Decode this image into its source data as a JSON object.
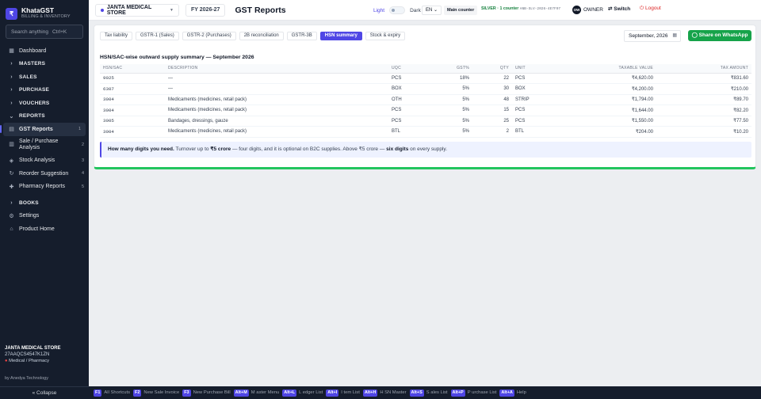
{
  "brand": {
    "name": "KhataGST",
    "tagline": "BILLING & INVENTORY",
    "logo": "₹"
  },
  "search": {
    "placeholder": "Search anything",
    "shortcut": "Ctrl+K"
  },
  "sidebar": {
    "items": [
      {
        "label": "Dashboard",
        "icon": "grid-icon",
        "type": "link"
      },
      {
        "label": "MASTERS",
        "type": "section"
      },
      {
        "label": "SALES",
        "type": "section"
      },
      {
        "label": "PURCHASE",
        "type": "section"
      },
      {
        "label": "VOUCHERS",
        "type": "section"
      },
      {
        "label": "REPORTS",
        "type": "section-open"
      },
      {
        "label": "GST Reports",
        "count": "1",
        "active": true
      },
      {
        "label": "Sale / Purchase Analysis",
        "count": "2"
      },
      {
        "label": "Stock Analysis",
        "count": "3"
      },
      {
        "label": "Reorder Suggestion",
        "count": "4"
      },
      {
        "label": "Pharmacy Reports",
        "count": "5"
      },
      {
        "label": "BOOKS",
        "type": "section"
      },
      {
        "label": "Settings",
        "icon": "gear-icon",
        "type": "link"
      },
      {
        "label": "Product Home",
        "icon": "home-icon",
        "type": "link"
      }
    ]
  },
  "store_info": {
    "name": "JANTA MEDICAL STORE",
    "gstin": "27AAQCS4547K1ZN",
    "type": "Medical / Pharmacy"
  },
  "byline": "by Anedya Technology",
  "collapse_label": "« Collapse",
  "topbar": {
    "store": "JANTA MEDICAL STORE",
    "fy": "FY 2026-27",
    "title": "GST Reports",
    "theme_light": "Light",
    "theme_dark": "Dark",
    "language": "EN",
    "counter": "Main counter",
    "license": "SILVER · 1 counter",
    "license_code": "ANB-SLV-2026-4E7F97",
    "avatar": "OW",
    "role": "OWNER",
    "switch": "Switch",
    "logout": "Logout"
  },
  "tabs": [
    "Tax liability",
    "GSTR-1 (Sales)",
    "GSTR-2 (Purchases)",
    "2B reconciliation",
    "GSTR-3B",
    "HSN summary",
    "Stock & expiry"
  ],
  "active_tab": "HSN summary",
  "period": "September, 2026",
  "share_label": "Share on WhatsApp",
  "table": {
    "title": "HSN/SAC-wise outward supply summary — September 2026",
    "headers": {
      "hsn": "HSN/SAC",
      "desc": "DESCRIPTION",
      "uqc": "UQC",
      "gst": "GST%",
      "qty": "QTY",
      "unit": "UNIT",
      "taxable": "TAXABLE VALUE",
      "tax": "TAX AMOUNT"
    },
    "rows": [
      {
        "hsn": "9025",
        "desc": "—",
        "uqc": "PCS",
        "gst": "18%",
        "qty": "22",
        "unit": "PCS",
        "taxable": "₹4,620.00",
        "tax": "₹831.60"
      },
      {
        "hsn": "6307",
        "desc": "—",
        "uqc": "BOX",
        "gst": "5%",
        "qty": "30",
        "unit": "BOX",
        "taxable": "₹4,200.00",
        "tax": "₹210.00"
      },
      {
        "hsn": "3004",
        "desc": "Medicaments (medicines, retail pack)",
        "uqc": "OTH",
        "gst": "5%",
        "qty": "48",
        "unit": "STRIP",
        "taxable": "₹1,794.00",
        "tax": "₹89.70"
      },
      {
        "hsn": "3004",
        "desc": "Medicaments (medicines, retail pack)",
        "uqc": "PCS",
        "gst": "5%",
        "qty": "15",
        "unit": "PCS",
        "taxable": "₹1,644.00",
        "tax": "₹82.20"
      },
      {
        "hsn": "3005",
        "desc": "Bandages, dressings, gauze",
        "uqc": "PCS",
        "gst": "5%",
        "qty": "25",
        "unit": "PCS",
        "taxable": "₹1,550.00",
        "tax": "₹77.50"
      },
      {
        "hsn": "3004",
        "desc": "Medicaments (medicines, retail pack)",
        "uqc": "BTL",
        "gst": "5%",
        "qty": "2",
        "unit": "BTL",
        "taxable": "₹204.00",
        "tax": "₹10.20"
      }
    ]
  },
  "note": {
    "lead": "How many digits you need.",
    "t1": " Turnover up to ",
    "b1": "₹5 crore",
    "t2": " — four digits, and it is optional on B2C supplies. Above ₹5 crore — ",
    "b2": "six digits",
    "t3": " on every supply."
  },
  "footer": [
    {
      "key": "F1",
      "label": "All Shortcuts"
    },
    {
      "key": "F2",
      "label": "New Sale Invoice"
    },
    {
      "key": "F3",
      "label": "New Purchase Bill"
    },
    {
      "key": "Alt+M",
      "label": "M aster Menu"
    },
    {
      "key": "Alt+L",
      "label": "L edger List"
    },
    {
      "key": "Alt+I",
      "label": "I tem List"
    },
    {
      "key": "Alt+H",
      "label": "H SN Master"
    },
    {
      "key": "Alt+S",
      "label": "S ales List"
    },
    {
      "key": "Alt+P",
      "label": "P urchase List"
    },
    {
      "key": "Alt+A",
      "label": "Help"
    }
  ]
}
